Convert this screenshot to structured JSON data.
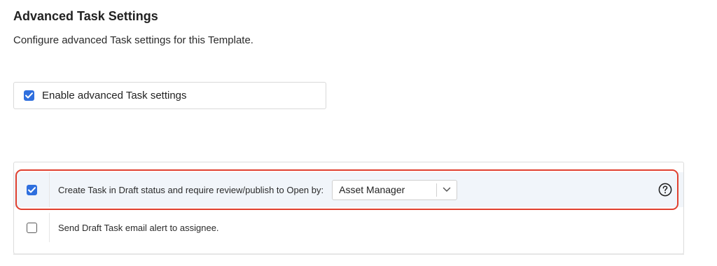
{
  "header": {
    "title": "Advanced Task Settings",
    "subtitle": "Configure advanced Task settings for this Template."
  },
  "enable_setting": {
    "label": "Enable advanced Task settings",
    "checked": true
  },
  "options": [
    {
      "label": "Create Task in Draft status and require review/publish to Open by:",
      "checked": true,
      "select_value": "Asset Manager",
      "help_icon": "question-circle-icon"
    },
    {
      "label": "Send Draft Task email alert to assignee.",
      "checked": false
    }
  ],
  "colors": {
    "accent": "#2f6fde",
    "highlight_outline": "#e0402f",
    "row_highlight_bg": "#f1f5fa"
  },
  "icons": [
    "checkbox-checked-icon",
    "chevron-down-icon",
    "question-circle-icon"
  ]
}
